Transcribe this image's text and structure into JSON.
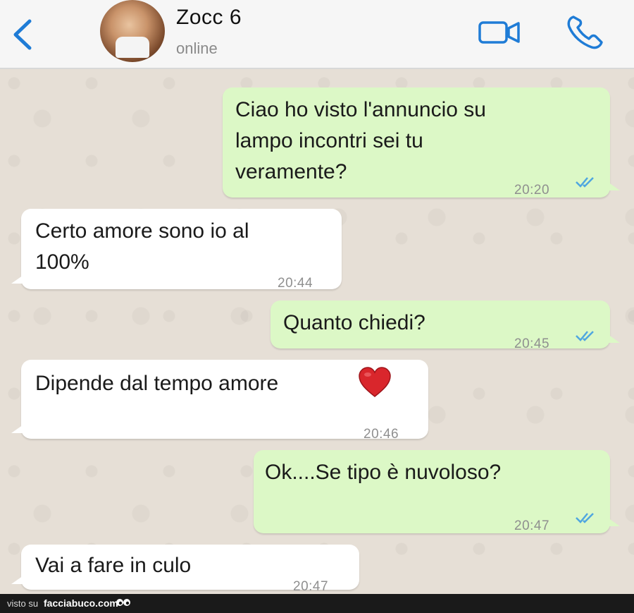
{
  "header": {
    "contact_name": "Zocc 6",
    "status": "online",
    "icons": {
      "back": "chevron-left-icon",
      "video": "video-camera-icon",
      "call": "phone-icon"
    },
    "accent_color": "#0a84ff"
  },
  "messages": [
    {
      "direction": "outgoing",
      "text": "Ciao ho visto l'annuncio su\nlampo incontri sei tu\nveramente?",
      "time": "20:20",
      "status": "read"
    },
    {
      "direction": "incoming",
      "text": "Certo amore sono io al\n100%",
      "time": "20:44"
    },
    {
      "direction": "outgoing",
      "text": "Quanto chiedi?",
      "time": "20:45",
      "status": "read"
    },
    {
      "direction": "incoming",
      "text": "Dipende dal tempo amore",
      "emoji": "red-heart",
      "time": "20:46"
    },
    {
      "direction": "outgoing",
      "text": "Ok....Se tipo è nuvoloso?",
      "time": "20:47",
      "status": "read"
    },
    {
      "direction": "incoming",
      "text": "Vai a fare in culo",
      "time": "20:47"
    }
  ],
  "colors": {
    "outgoing_bubble": "#dcf8c6",
    "incoming_bubble": "#ffffff",
    "read_ticks": "#4fa6e0",
    "chat_background": "#e6dfd6"
  },
  "watermark": {
    "prefix": "visto su",
    "site": "facciabuco.com"
  }
}
